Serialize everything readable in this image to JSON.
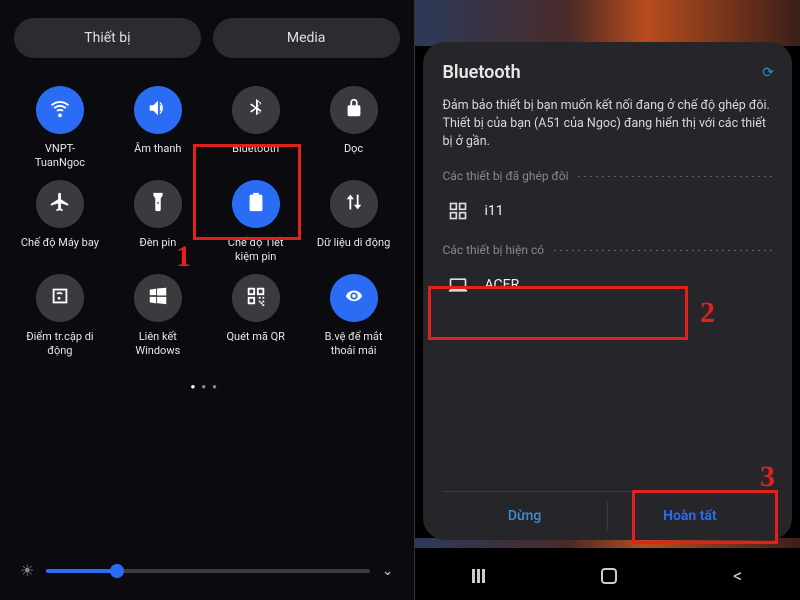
{
  "left": {
    "tabs": {
      "device": "Thiết bị",
      "media": "Media"
    },
    "tiles": [
      {
        "label": "VNPT-TuanNgoc",
        "active": true,
        "icon": "wifi"
      },
      {
        "label": "Âm thanh",
        "active": true,
        "icon": "sound"
      },
      {
        "label": "Bluetooth",
        "active": false,
        "icon": "bluetooth"
      },
      {
        "label": "Dọc",
        "active": false,
        "icon": "lock"
      },
      {
        "label": "Chế độ Máy bay",
        "active": false,
        "icon": "airplane"
      },
      {
        "label": "Đèn pin",
        "active": false,
        "icon": "flashlight"
      },
      {
        "label": "Chế độ Tiết kiệm pin",
        "active": true,
        "icon": "battery"
      },
      {
        "label": "Dữ liệu di động",
        "active": false,
        "icon": "data"
      },
      {
        "label": "Điểm tr.cập di động",
        "active": false,
        "icon": "hotspot"
      },
      {
        "label": "Liên kết Windows",
        "active": false,
        "icon": "windows"
      },
      {
        "label": "Quét mã QR",
        "active": false,
        "icon": "qr"
      },
      {
        "label": "B.vệ để mắt thoải mái",
        "active": true,
        "icon": "eye"
      }
    ],
    "brightness_percent": 22
  },
  "right": {
    "title": "Bluetooth",
    "description": "Đảm bảo thiết bị bạn muốn kết nối đang ở chế độ ghép đôi. Thiết bị của bạn (A51 của Ngoc) đang hiển thị với các thiết bị ở gần.",
    "paired_header": "Các thiết bị đã ghép đôi",
    "available_header": "Các thiết bị hiện có",
    "paired": [
      {
        "name": "i11",
        "icon": "grid"
      }
    ],
    "available": [
      {
        "name": "ACER",
        "icon": "laptop"
      }
    ],
    "actions": {
      "stop": "Dừng",
      "done": "Hoàn tất"
    }
  },
  "annotations": {
    "a1": "1",
    "a2": "2",
    "a3": "3"
  }
}
